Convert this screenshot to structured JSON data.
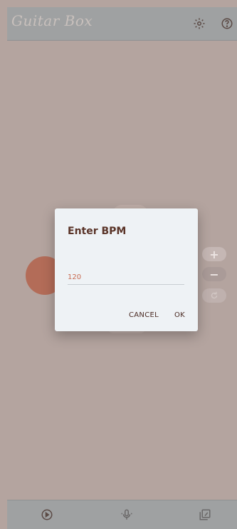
{
  "app": {
    "logo_text": "Guitar Box"
  },
  "appbar": {
    "settings_icon": "gear-icon",
    "help_icon": "help-icon"
  },
  "side_controls": {
    "increment_symbol": "+",
    "decrement_symbol": "−",
    "reset_icon": "reset-icon"
  },
  "dialog": {
    "title": "Enter BPM",
    "input_value": "120",
    "cancel_label": "CANCEL",
    "ok_label": "OK"
  },
  "bottom_nav": {
    "items": [
      {
        "icon": "play-circle-icon"
      },
      {
        "icon": "microphone-icon"
      },
      {
        "icon": "music-library-icon"
      }
    ]
  },
  "colors": {
    "background": "#b4a49f",
    "appbar": "#9fa1a2",
    "accent_red": "#b36c58",
    "dialog_bg": "#eef2f5",
    "title_text": "#5a3428",
    "input_text": "#c96c52"
  }
}
